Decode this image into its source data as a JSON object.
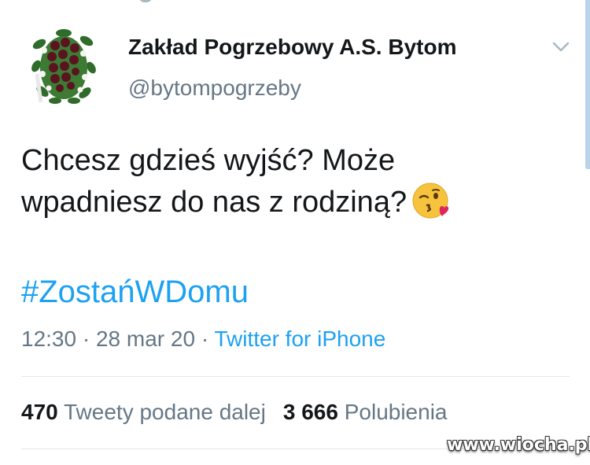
{
  "author": {
    "name": "Zakład Pogrzebowy A.S. Bytom",
    "handle": "@bytompogrzeby",
    "avatar_icon": "funeral-wreath-icon"
  },
  "tweet": {
    "line1": "Chcesz gdzieś wyjść? Może",
    "line2": "wpadniesz do nas z rodziną?",
    "emoji_icon": "face-blowing-kiss-icon",
    "hashtag": "#ZostańWDomu",
    "time": "12:30",
    "date": "28 mar 20",
    "separator": "·",
    "source": "Twitter for iPhone"
  },
  "stats": {
    "retweets_count": "470",
    "retweets_label": "Tweety podane dalej",
    "likes_count": "3 666",
    "likes_label": "Polubienia"
  },
  "watermark": "www.wiocha.pl",
  "colors": {
    "link": "#1da1f2",
    "secondary_text": "#657786",
    "primary_text": "#14171a",
    "divider": "#e1e8ed"
  }
}
